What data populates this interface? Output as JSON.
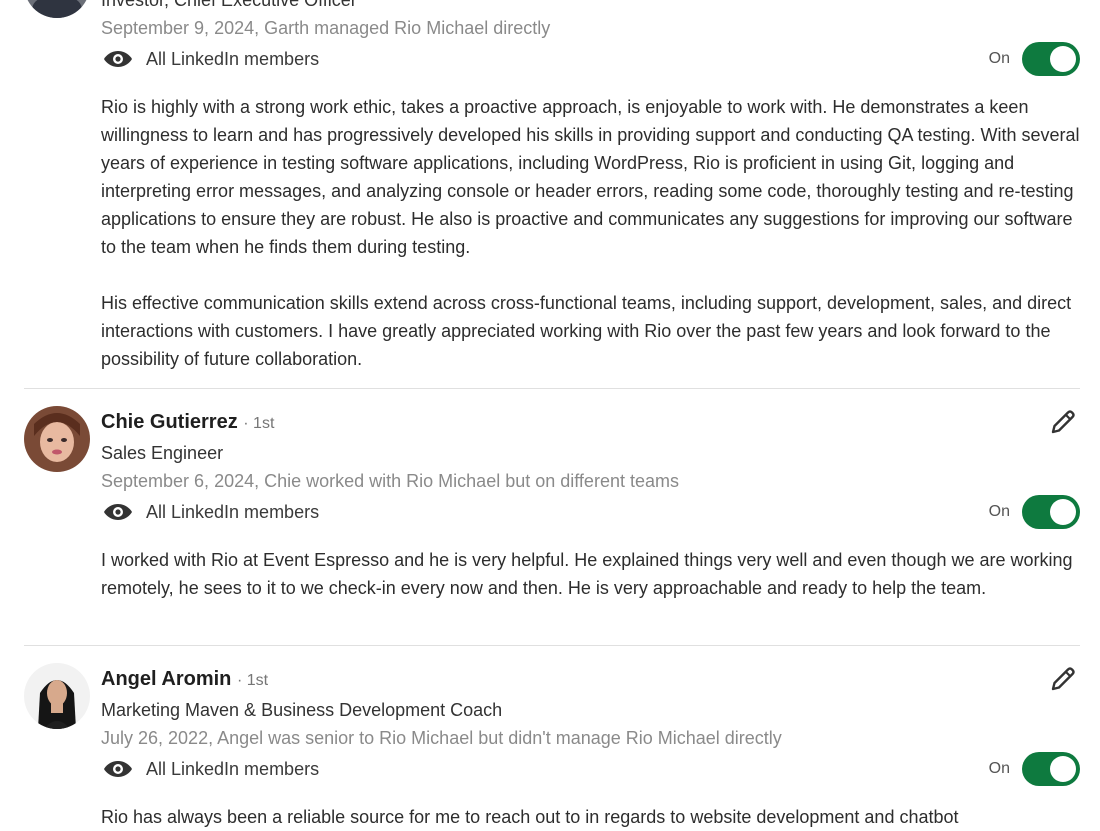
{
  "recommendations": [
    {
      "headline": "Investor, Chief Executive Officer",
      "meta": "September 9, 2024, Garth managed Rio Michael directly",
      "visibility": "All LinkedIn members",
      "toggle_label": "On",
      "toggle_state": "on",
      "paragraphs": [
        "Rio is highly with a strong work ethic, takes a proactive approach, is enjoyable to work with. He demonstrates a keen willingness to learn and has progressively developed his skills in providing support and conducting QA testing. With several years of experience in testing software applications, including WordPress, Rio is proficient in using Git, logging and interpreting error messages, and analyzing console or header errors, reading some code, thoroughly testing and re-testing applications to ensure they are robust. He also is proactive and communicates any suggestions for improving our software to the team when he finds them during testing.",
        "His effective communication skills extend across cross-functional teams, including support, development, sales, and direct interactions with customers. I have greatly appreciated working with Rio over the past few years and look forward to the possibility of future collaboration."
      ]
    },
    {
      "name": "Chie Gutierrez",
      "degree": "· 1st",
      "headline": "Sales Engineer",
      "meta": "September 6, 2024, Chie worked with Rio Michael but on different teams",
      "visibility": "All LinkedIn members",
      "toggle_label": "On",
      "toggle_state": "on",
      "paragraphs": [
        "I worked with Rio at Event Espresso and he is very helpful. He explained things very well and even though we are working remotely, he sees to it to we check-in every now and then. He is very approachable and ready to help the team."
      ]
    },
    {
      "name": "Angel Aromin",
      "degree": "· 1st",
      "headline": "Marketing Maven & Business Development Coach",
      "meta": "July 26, 2022, Angel was senior to Rio Michael but didn't manage Rio Michael directly",
      "visibility": "All LinkedIn members",
      "toggle_label": "On",
      "toggle_state": "on",
      "paragraphs": [
        "Rio has always been a reliable source for me to reach out to in regards to website development and chatbot"
      ]
    }
  ],
  "icons": {
    "visibility": "eye-icon",
    "edit": "pencil-icon"
  },
  "colors": {
    "toggle_on": "#0e7a3f",
    "meta_text": "#8a8a8a"
  }
}
